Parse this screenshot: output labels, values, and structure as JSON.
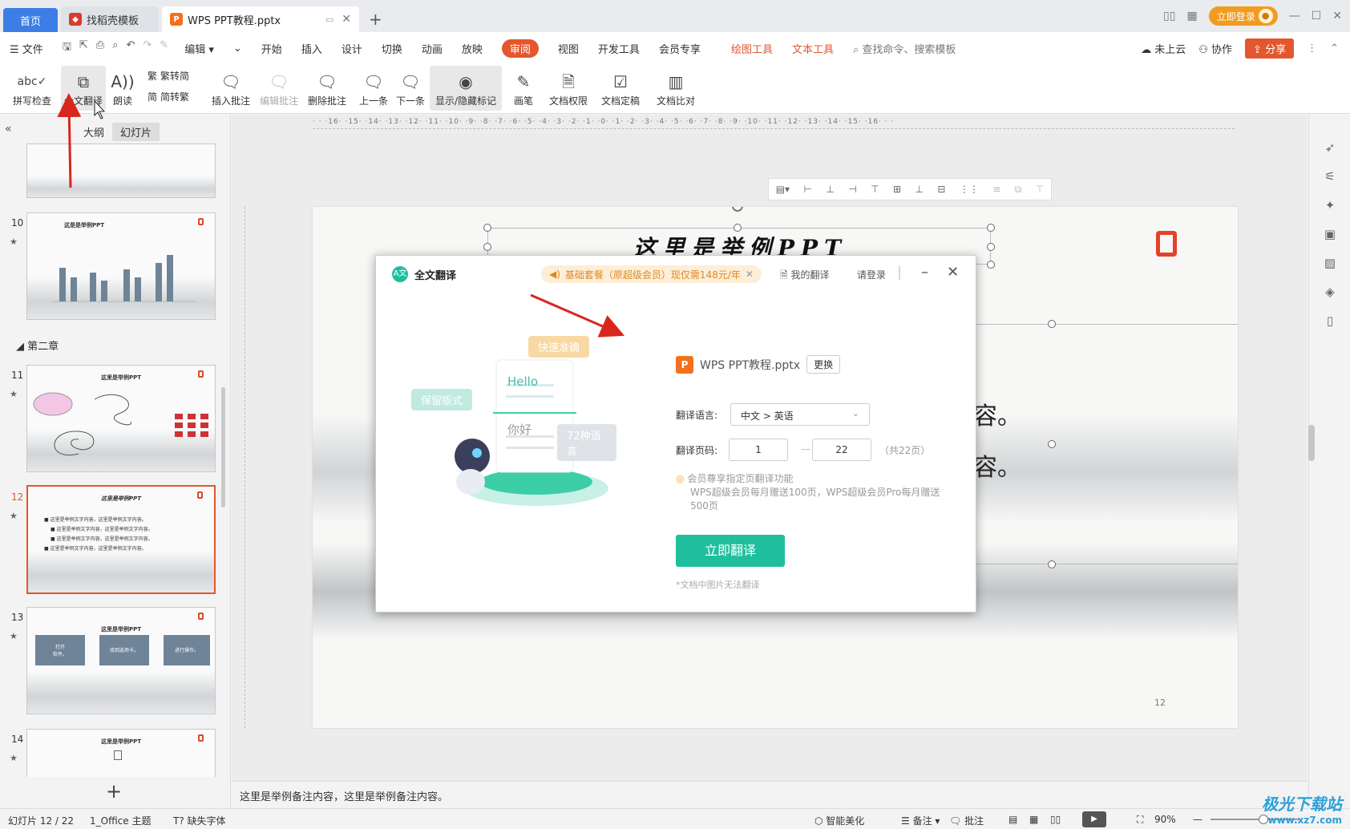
{
  "titlebar": {
    "tabs": [
      {
        "label": "首页"
      },
      {
        "label": "找稻壳模板"
      },
      {
        "label": "WPS PPT教程.pptx"
      }
    ],
    "login_label": "立即登录"
  },
  "menubar": {
    "file_label": "文件",
    "edit_label": "编辑",
    "items": [
      "开始",
      "插入",
      "设计",
      "切换",
      "动画",
      "放映",
      "审阅",
      "视图",
      "开发工具",
      "会员专享"
    ],
    "active_item": "审阅",
    "tool_items": [
      "绘图工具",
      "文本工具"
    ],
    "search_placeholder": "查找命令、搜索模板",
    "cloud_label": "未上云",
    "collab_label": "协作",
    "share_label": "分享"
  },
  "ribbon": {
    "spellcheck": "拼写检查",
    "full_translate": "全文翻译",
    "read_aloud": "朗读",
    "trad_to_simp": "繁转简",
    "simp_to_trad": "简转繁",
    "insert_comment": "插入批注",
    "edit_comment": "编辑批注",
    "delete_comment": "删除批注",
    "prev": "上一条",
    "next": "下一条",
    "show_hide_marks": "显示/隐藏标记",
    "pen": "画笔",
    "doc_permission": "文档权限",
    "doc_finalize": "文档定稿",
    "doc_compare": "文档比对"
  },
  "leftpanel": {
    "tab_outline": "大纲",
    "tab_slides": "幻灯片",
    "section_label": "第二章",
    "slides": [
      {
        "num": "10",
        "title": "这是是举例PPT"
      },
      {
        "num": "11",
        "title": "这里是举例PPT"
      },
      {
        "num": "12",
        "title": "这里是举例PPT"
      },
      {
        "num": "13",
        "title": "这里是举例PPT"
      },
      {
        "num": "14",
        "title": "这里是举例PPT"
      }
    ],
    "thumb13_boxes": [
      "打开\n软件。",
      "找到选项卡。",
      "进行操作。"
    ],
    "thumb12_lines": [
      "这里是举例文字内容，这里是举例文字内容。",
      "这里是举例文字内容，这里是举例文字内容。",
      "这里是举例文字内容，这里是举例文字内容。",
      "这里是举例文字内容，这里是举例文字内容。"
    ]
  },
  "slide": {
    "title": "这里是举例PPT",
    "body_line1": "容。",
    "body_line2": "容。",
    "page_number": "12"
  },
  "dialog": {
    "title": "全文翻译",
    "promo": "基础套餐（原超级会员）现仅需148元/年",
    "my_translations": "我的翻译",
    "login": "请登录",
    "bubble_fast": "快速准确",
    "bubble_keep": "保留版式",
    "bubble_lang": "72种语言",
    "hello": "Hello",
    "nihao": "你好",
    "file_name": "WPS PPT教程.pptx",
    "change_label": "更换",
    "lang_label": "翻译语言:",
    "lang_value": "中文 > 英语",
    "page_label": "翻译页码:",
    "page_from": "1",
    "page_to": "22",
    "page_total": "（共22页）",
    "vip_title": "会员尊享指定页翻译功能",
    "vip_desc": "WPS超级会员每月赠送100页，WPS超级会员Pro每月赠送500页",
    "translate_btn": "立即翻译",
    "footnote": "*文档中图片无法翻译"
  },
  "notes": {
    "text": "这里是举例备注内容，这里是举例备注内容。"
  },
  "statusbar": {
    "slide_pos": "幻灯片 12 / 22",
    "theme": "1_Office 主题",
    "missing_font": "缺失字体",
    "beautify": "智能美化",
    "notes": "备注",
    "comments": "批注",
    "zoom": "90%"
  },
  "watermark": {
    "name": "极光下载站",
    "url": "www.xz7.com"
  },
  "colors": {
    "accent": "#e4572e",
    "teal": "#1fbf9e",
    "tab_blue": "#3d7ee6"
  }
}
